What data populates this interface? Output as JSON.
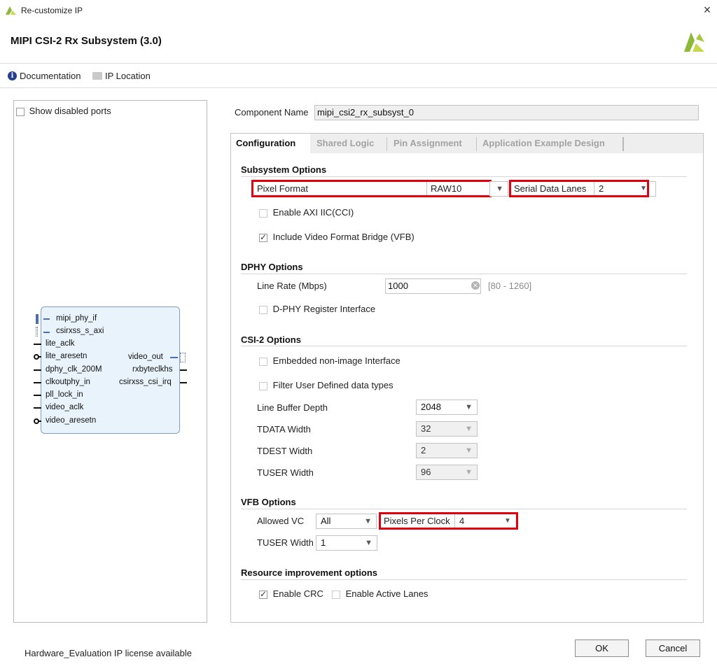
{
  "window": {
    "title": "Re-customize IP",
    "close_icon": "×"
  },
  "header": {
    "ip_title": "MIPI CSI-2 Rx Subsystem (3.0)"
  },
  "toolbar": {
    "documentation": "Documentation",
    "ip_location": "IP Location"
  },
  "left": {
    "show_disabled_ports": "Show disabled ports",
    "block": {
      "left_ports": [
        "mipi_phy_if",
        "csirxss_s_axi",
        "lite_aclk",
        "lite_aresetn",
        "dphy_clk_200M",
        "clkoutphy_in",
        "pll_lock_in",
        "video_aclk",
        "video_aresetn"
      ],
      "right_ports": [
        "video_out",
        "rxbyteclkhs",
        "csirxss_csi_irq"
      ]
    }
  },
  "component": {
    "label": "Component Name",
    "value": "mipi_csi2_rx_subsyst_0"
  },
  "tabs": [
    "Configuration",
    "Shared Logic",
    "Pin Assignment",
    "Application Example Design"
  ],
  "subsystem": {
    "title": "Subsystem Options",
    "pixel_format_label": "Pixel Format",
    "pixel_format_value": "RAW10",
    "serial_lanes_label": "Serial Data Lanes",
    "serial_lanes_value": "2",
    "enable_axi_iic": "Enable AXI IIC(CCI)",
    "include_vfb": "Include Video Format Bridge (VFB)"
  },
  "dphy": {
    "title": "DPHY Options",
    "line_rate_label": "Line Rate (Mbps)",
    "line_rate_value": "1000",
    "line_rate_range": "[80 - 1260]",
    "register_interface": "D-PHY Register Interface"
  },
  "csi2": {
    "title": "CSI-2 Options",
    "embedded": "Embedded non-image Interface",
    "filter": "Filter User Defined data types",
    "line_buffer_label": "Line Buffer Depth",
    "line_buffer_value": "2048",
    "tdata_label": "TDATA Width",
    "tdata_value": "32",
    "tdest_label": "TDEST Width",
    "tdest_value": "2",
    "tuser_label": "TUSER Width",
    "tuser_value": "96"
  },
  "vfb": {
    "title": "VFB Options",
    "allowed_vc_label": "Allowed VC",
    "allowed_vc_value": "All",
    "ppc_label": "Pixels Per Clock",
    "ppc_value": "4",
    "tuser_label": "TUSER Width",
    "tuser_value": "1"
  },
  "resource": {
    "title": "Resource improvement options",
    "enable_crc": "Enable CRC",
    "enable_active_lanes": "Enable Active Lanes"
  },
  "footer": {
    "license": "Hardware_Evaluation IP license available",
    "ok": "OK",
    "cancel": "Cancel"
  },
  "colors": {
    "highlight": "#e0000e",
    "logo": "#8db83a"
  }
}
